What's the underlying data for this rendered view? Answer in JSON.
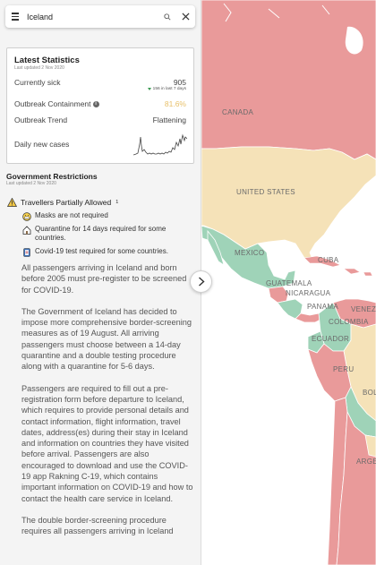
{
  "search": {
    "value": "Iceland",
    "icon": "search-icon"
  },
  "stats": {
    "title": "Latest Statistics",
    "updated": "Last updated 2 Nov 2020",
    "currently_sick_label": "Currently sick",
    "currently_sick_value": "905",
    "currently_sick_change": "156 in last 7 days",
    "containment_label": "Outbreak Containment",
    "containment_value": "81.6%",
    "containment_color": "#e8c06a",
    "trend_label": "Outbreak Trend",
    "trend_value": "Flattening",
    "daily_label": "Daily new cases"
  },
  "government": {
    "title": "Government Restrictions",
    "updated": "Last updated 2 Nov 2020",
    "travel_status": "Travellers Partially Allowed",
    "travel_status_sup": "1",
    "rules": [
      {
        "icon": "mask-icon",
        "text": "Masks are not required"
      },
      {
        "icon": "house-icon",
        "text": "Quarantine for 14 days required for some countries."
      },
      {
        "icon": "test-kit-icon",
        "text": "Covid-19 test required for some countries."
      }
    ],
    "paragraphs": [
      "All passengers arriving in Iceland and born before 2005 must pre-register to be screened for COVID-19.",
      "The Government of Iceland has decided to impose more comprehensive border-screening measures as of 19 August. All arriving passengers must choose between a 14-day quarantine and a double testing procedure along with a quarantine for 5-6 days.",
      "Passengers are required to fill out a pre-registration form before departure to Iceland, which requires to provide personal details and contact information, flight information, travel dates, address(es) during their stay in Iceland and information on countries they have visited before arrival. Passengers are also encouraged to download and use the COVID-19 app Rakning C-19, which contains important information on COVID-19 and how to contact the health care service in Iceland.",
      "The double border-screening procedure requires all passengers arriving in Iceland"
    ]
  },
  "map": {
    "labels": {
      "canada": "CANADA",
      "united_states": "UNITED STATES",
      "mexico": "MEXICO",
      "cuba": "CUBA",
      "guatemala": "GUATEMALA",
      "nicaragua": "NICARAGUA",
      "panama": "PANAMA",
      "venezuela": "VENEZ",
      "colombia": "COLOMBIA",
      "ecuador": "ECUADOR",
      "peru": "PERU",
      "bolivia": "BOL",
      "argentina": "ARGE"
    },
    "colors": {
      "high_risk": "#e99a9a",
      "medium_risk": "#f5e2b8",
      "low_risk": "#9fd3b8",
      "water": "#ffffff"
    }
  }
}
